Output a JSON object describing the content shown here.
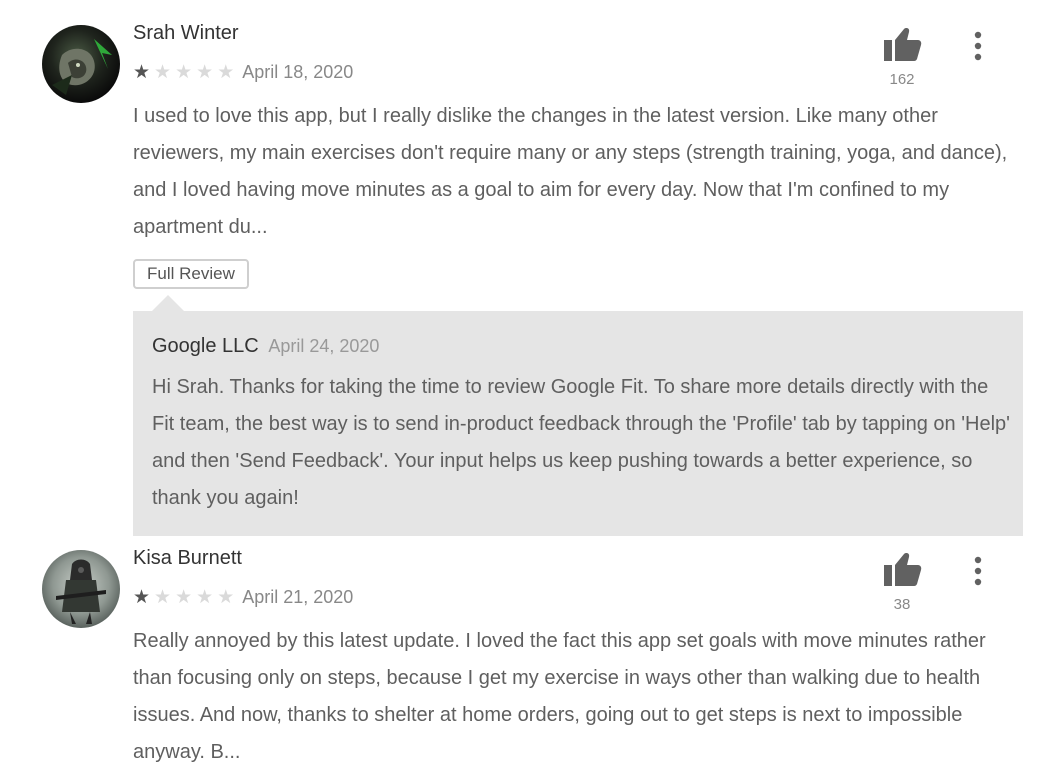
{
  "reviews": [
    {
      "author": "Srah Winter",
      "rating": 1,
      "date": "April 18, 2020",
      "helpful_count": "162",
      "text": "I used to love this app, but I really dislike the changes in the latest version. Like many other reviewers, my main exercises don't require many or any steps (strength training, yoga, and dance), and I loved having move minutes as a goal to aim for every day. Now that I'm confined to my apartment du...",
      "full_review_label": "Full Review",
      "reply": {
        "author": "Google LLC",
        "date": "April 24, 2020",
        "text": "Hi Srah. Thanks for taking the time to review Google Fit. To share more details directly with the Fit team, the best way is to send in-product feedback through the 'Profile' tab by tapping on 'Help' and then 'Send Feedback'. Your input helps us keep pushing towards a better experience, so thank you again!"
      }
    },
    {
      "author": "Kisa Burnett",
      "rating": 1,
      "date": "April 21, 2020",
      "helpful_count": "38",
      "text": "Really annoyed by this latest update. I loved the fact this app set goals with move minutes rather than focusing only on steps, because I get my exercise in ways other than walking due to health issues. And now, thanks to shelter at home orders, going out to get steps is next to impossible anyway. B..."
    }
  ],
  "icons": {
    "thumb": "thumbs-up-icon",
    "menu": "more-vert-icon",
    "star": "star-icon"
  },
  "colors": {
    "star_filled": "#555555",
    "star_empty": "#dadada",
    "reply_bg": "#e5e5e5",
    "body_text": "#5f5f5f"
  }
}
